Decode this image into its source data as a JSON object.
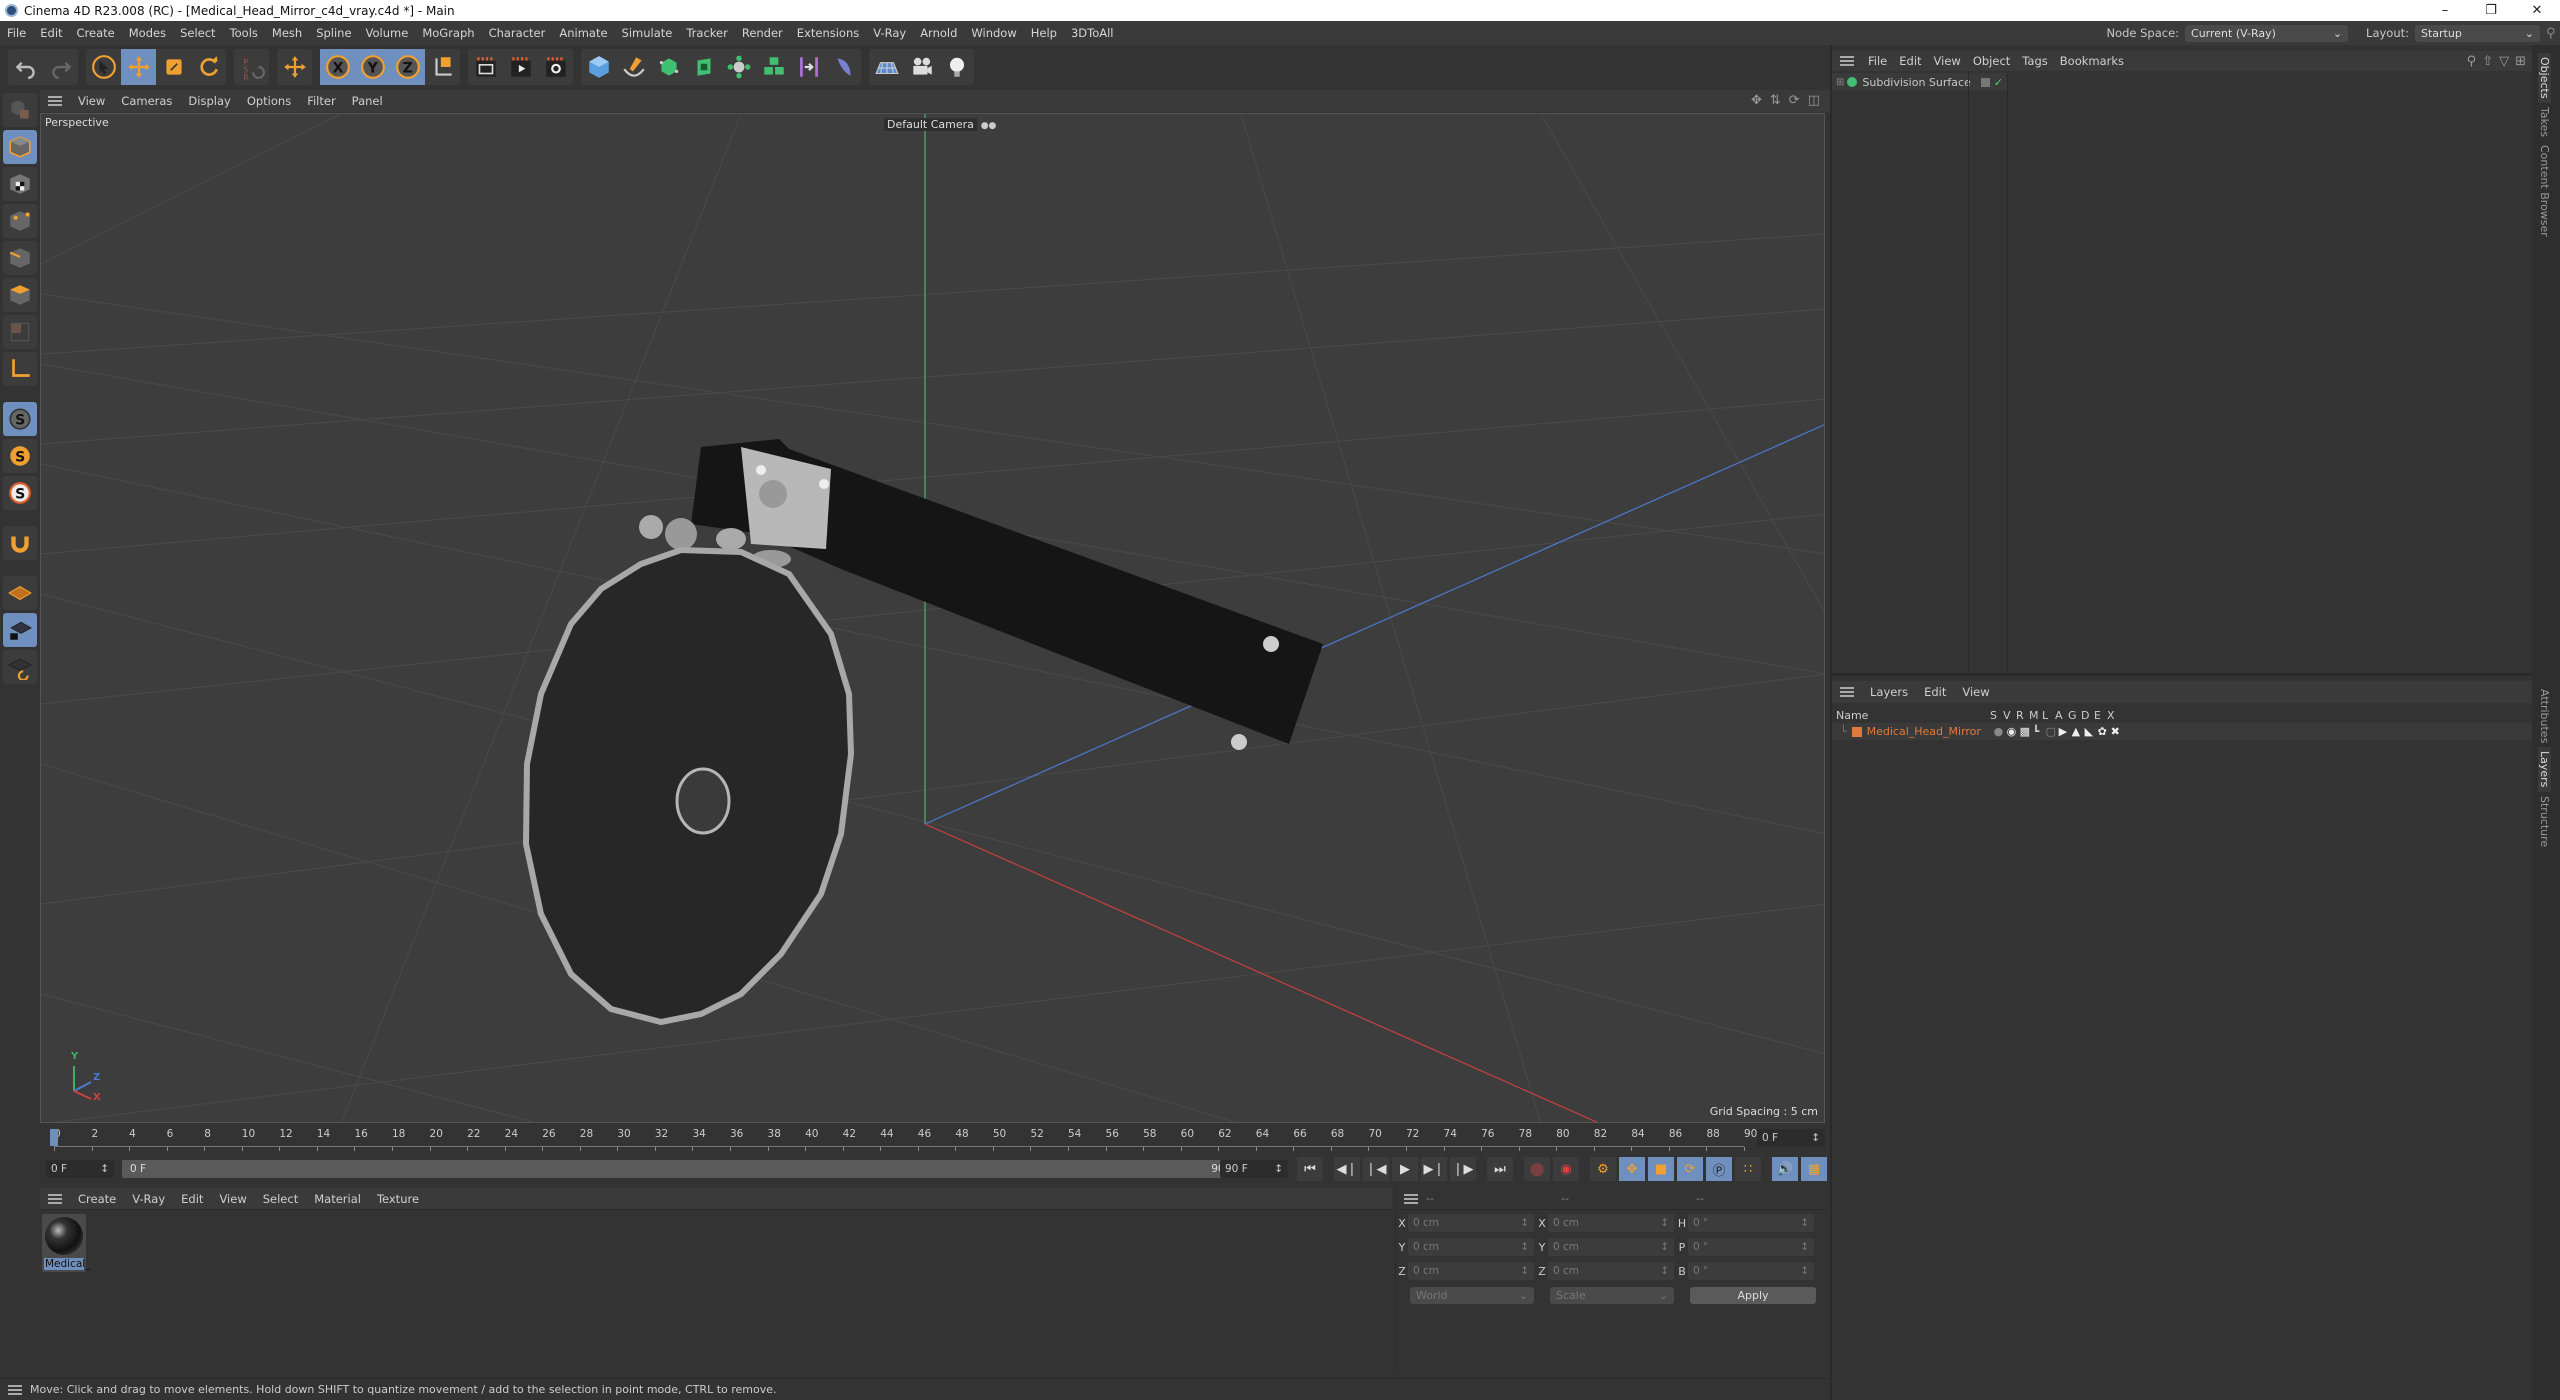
{
  "window": {
    "title": "Cinema 4D R23.008 (RC) - [Medical_Head_Mirror_c4d_vray.c4d *] - Main",
    "controls": [
      "minimize",
      "restore",
      "close"
    ]
  },
  "menubar": {
    "items": [
      "File",
      "Edit",
      "Create",
      "Modes",
      "Select",
      "Tools",
      "Mesh",
      "Spline",
      "Volume",
      "MoGraph",
      "Character",
      "Animate",
      "Simulate",
      "Tracker",
      "Render",
      "Extensions",
      "V-Ray",
      "Arnold",
      "Window",
      "Help",
      "3DToAll"
    ],
    "node_space_label": "Node Space:",
    "node_space_value": "Current (V-Ray)",
    "layout_label": "Layout:",
    "layout_value": "Startup"
  },
  "toolbar": {
    "groups": [
      [
        "undo-icon",
        "redo-icon"
      ],
      [
        "select-icon",
        "move-icon",
        "scale-icon",
        "rotate-icon"
      ],
      [
        "psr-icon"
      ],
      [
        "last-tool-icon"
      ],
      [
        "x-axis-icon",
        "y-axis-icon",
        "z-axis-icon",
        "coordinate-system-icon"
      ],
      [
        "render-view-icon",
        "render-picture-viewer-icon",
        "render-settings-icon"
      ],
      [
        "cube-icon",
        "pen-icon",
        "subdivision-icon",
        "extrude-icon",
        "mograph-cloner-icon",
        "array-icon",
        "deformer-icon",
        "field-icon"
      ],
      [
        "floor-icon",
        "camera-icon",
        "light-icon"
      ]
    ],
    "active": [
      "move-icon",
      "x-axis-icon",
      "y-axis-icon",
      "z-axis-icon"
    ]
  },
  "left_tools": {
    "items": [
      "make-editable-icon",
      "model-mode-icon",
      "texture-mode-icon",
      "points-mode-icon",
      "edges-mode-icon",
      "polygons-mode-icon",
      "uv-mode-icon",
      "axis-mode-icon",
      "snap-icon",
      "snap-settings-icon",
      "snap-workplane-icon",
      "magnet-icon",
      "workplane-icon",
      "locked-workplane-icon",
      "planar-workplane-icon"
    ],
    "active": [
      "model-mode-icon",
      "snap-icon",
      "locked-workplane-icon"
    ]
  },
  "viewport": {
    "menu": [
      "View",
      "Cameras",
      "Display",
      "Options",
      "Filter",
      "Panel"
    ],
    "label": "Perspective",
    "camera": "Default Camera",
    "grid_spacing": "Grid Spacing : 5 cm",
    "axis_labels": {
      "x": "X",
      "y": "Y",
      "z": "Z"
    }
  },
  "timeline": {
    "ticks": [
      "0",
      "2",
      "4",
      "6",
      "8",
      "10",
      "12",
      "14",
      "16",
      "18",
      "20",
      "22",
      "24",
      "26",
      "28",
      "30",
      "32",
      "34",
      "36",
      "38",
      "40",
      "42",
      "44",
      "46",
      "48",
      "50",
      "52",
      "54",
      "56",
      "58",
      "60",
      "62",
      "64",
      "66",
      "68",
      "70",
      "72",
      "74",
      "76",
      "78",
      "80",
      "82",
      "84",
      "86",
      "88",
      "90"
    ],
    "current_frame": "0 F",
    "start_frame": "0 F",
    "range_start": "0 F",
    "range_end": "90 F",
    "end_frame": "90 F"
  },
  "materials": {
    "menu": [
      "Create",
      "V-Ray",
      "Edit",
      "View",
      "Select",
      "Material",
      "Texture"
    ],
    "items": [
      {
        "name": "Medical_"
      }
    ]
  },
  "coordinates": {
    "headers": [
      "--",
      "--",
      "--"
    ],
    "position": [
      {
        "axis": "X",
        "value": "0 cm"
      },
      {
        "axis": "Y",
        "value": "0 cm"
      },
      {
        "axis": "Z",
        "value": "0 cm"
      }
    ],
    "size": [
      {
        "axis": "X",
        "value": "0 cm"
      },
      {
        "axis": "Y",
        "value": "0 cm"
      },
      {
        "axis": "Z",
        "value": "0 cm"
      }
    ],
    "rotation": [
      {
        "axis": "H",
        "value": "0 °"
      },
      {
        "axis": "P",
        "value": "0 °"
      },
      {
        "axis": "B",
        "value": "0 °"
      }
    ],
    "space": "World",
    "mode": "Scale",
    "apply_label": "Apply"
  },
  "status": {
    "text": "Move: Click and drag to move elements. Hold down SHIFT to quantize movement / add to the selection in point mode, CTRL to remove."
  },
  "objects_panel": {
    "menu": [
      "File",
      "Edit",
      "View",
      "Object",
      "Tags",
      "Bookmarks"
    ],
    "items": [
      {
        "name": "Subdivision Surface"
      }
    ]
  },
  "layers_panel": {
    "menu": [
      "Layers",
      "Edit",
      "View"
    ],
    "columns": [
      "Name",
      "S",
      "V",
      "R",
      "M",
      "L",
      "A",
      "G",
      "D",
      "E",
      "X"
    ],
    "rows": [
      {
        "name": "Medical_Head_Mirror",
        "color": "#e07a3a"
      }
    ]
  },
  "side_tabs": {
    "top": [
      "Objects",
      "Takes",
      "Content Browser"
    ],
    "bottom": [
      "Attributes",
      "Layers",
      "Structure"
    ],
    "active_top": "Objects",
    "active_bottom": "Layers"
  },
  "colors": {
    "accent_orange": "#f0a030",
    "active_blue": "#6f8fbe",
    "axis_x": "#d04040",
    "axis_y": "#40b060",
    "axis_z": "#4a7ad0"
  }
}
